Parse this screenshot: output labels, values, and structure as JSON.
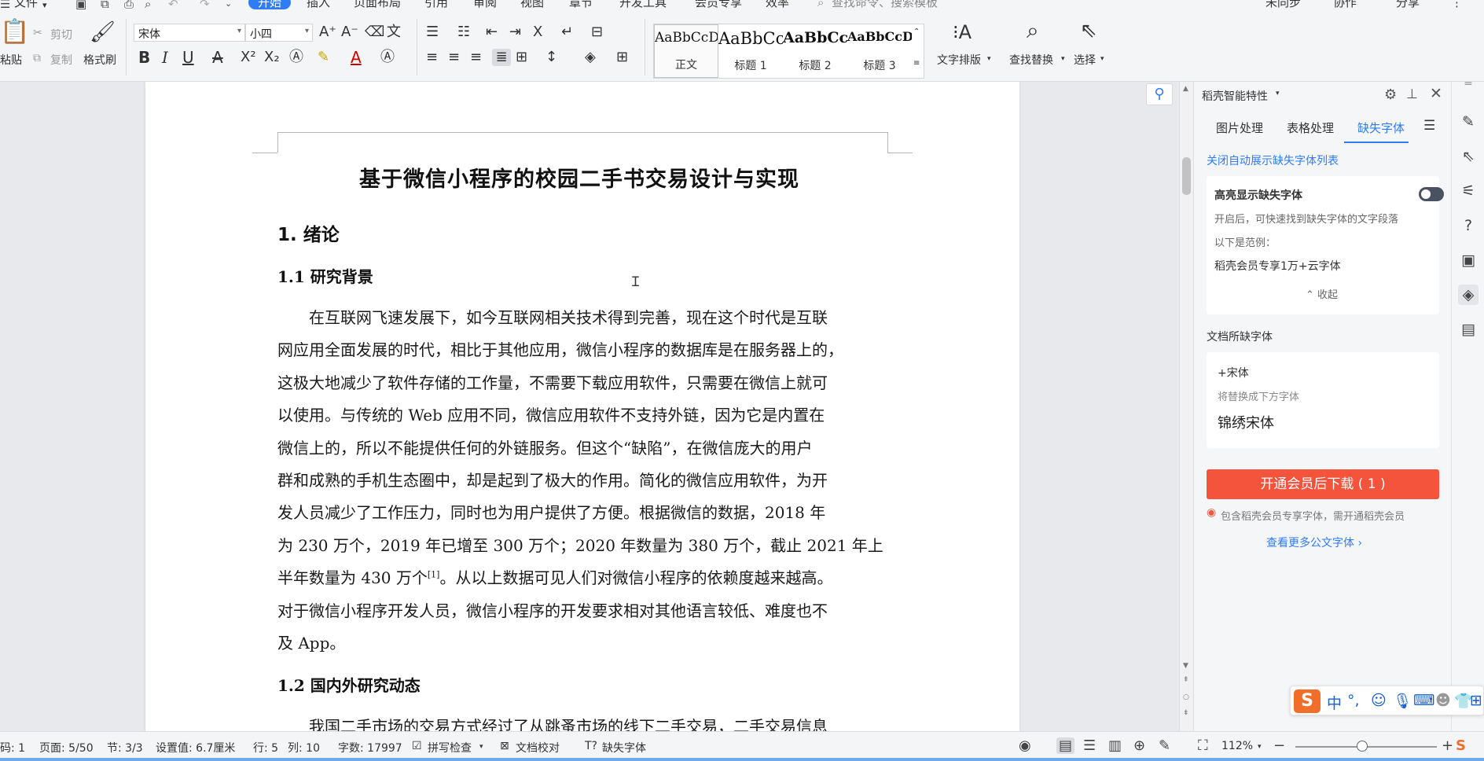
{
  "menu": {
    "file": "文件",
    "tabs": [
      "开始",
      "插入",
      "页面布局",
      "引用",
      "审阅",
      "视图",
      "章节",
      "开发工具",
      "会员专享",
      "效率"
    ],
    "active_tab": "开始",
    "search_placeholder": "查找命令、搜索模板",
    "sync": "未同步",
    "collab": "协作",
    "share": "分享"
  },
  "ribbon": {
    "paste": "粘贴",
    "cut": "剪切",
    "copy": "复制",
    "format_painter": "格式刷",
    "font_name": "宋体",
    "font_size": "小四",
    "styles": [
      {
        "preview": "AaBbCcDd",
        "name": "正文"
      },
      {
        "preview": "AaBbCc",
        "name": "标题 1"
      },
      {
        "preview": "AaBbCcI",
        "name": "标题 2"
      },
      {
        "preview": "AaBbCcDd",
        "name": "标题 3"
      }
    ],
    "text_layout": "文字排版",
    "find_replace": "查找替换",
    "select": "选择"
  },
  "document": {
    "title": "基于微信小程序的校园二手书交易设计与实现",
    "h1": "1. 绪论",
    "h2_1": "1.1  研究背景",
    "h2_2": "1.2  国内外研究动态",
    "para1_lines": [
      "　　在互联网飞速发展下，如今互联网相关技术得到完善，现在这个时代是互联",
      "网应用全面发展的时代，相比于其他应用，微信小程序的数据库是在服务器上的，",
      "这极大地减少了软件存储的工作量，不需要下载应用软件，只需要在微信上就可",
      "以使用。与传统的 Web 应用不同，微信应用软件不支持外链，因为它是内置在",
      "微信上的，所以不能提供任何的外链服务。但这个“缺陷”，在微信庞大的用户",
      "群和成熟的手机生态圈中，却是起到了极大的作用。简化的微信应用软件，为开",
      "发人员减少了工作压力，同时也为用户提供了方便。根据微信的数据，2018 年",
      "为 230 万个，2019 年已增至 300 万个；2020 年数量为 380 万个，截止 2021 年上"
    ],
    "para1_line9_pre": "半年数量为 430 万个",
    "para1_line9_sup": "[1]",
    "para1_line9_post": "。从以上数据可见人们对微信小程序的依赖度越来越高。",
    "para1_line10": "对于微信小程序开发人员，微信小程序的开发要求相对其他语言较低、难度也不",
    "para1_line11": "及 App。",
    "para2_line1": "　　我国二手市场的交易方式经过了从跳蚤市场的线下二手交易，二手交易信息"
  },
  "panel": {
    "title": "稻壳智能特性",
    "tabs": [
      "图片处理",
      "表格处理",
      "缺失字体"
    ],
    "active_tab": "缺失字体",
    "close_auto": "关闭自动展示缺失字体列表",
    "highlight_label": "高亮显示缺失字体",
    "desc": "开启后，可快速找到缺失字体的文字段落",
    "example_label": "以下是范例：",
    "example_text": "稻壳会员专享1万+云字体",
    "collapse": "收起",
    "missing_title": "文档所缺字体",
    "missing_font": "+宋体",
    "replace_hint": "将替换成下方字体",
    "replace_font": "锦绣宋体",
    "vip_button": "开通会员后下载 ( 1 )",
    "vip_note": "包含稻壳会员专享字体，需开通稻壳会员",
    "more_link": "查看更多公文字体 ›",
    "accent": "#2f7cf6",
    "vip_color": "#f4533c"
  },
  "ime": {
    "mode": "中"
  },
  "status": {
    "page_code": "码: 1",
    "page": "页面: 5/50",
    "section": "节: 3/3",
    "setting": "设置值: 6.7厘米",
    "row": "行: 5",
    "col": "列: 10",
    "words": "字数: 17997",
    "spell": "拼写检查",
    "proof": "文档校对",
    "missing_font": "缺失字体",
    "zoom": "112%"
  }
}
